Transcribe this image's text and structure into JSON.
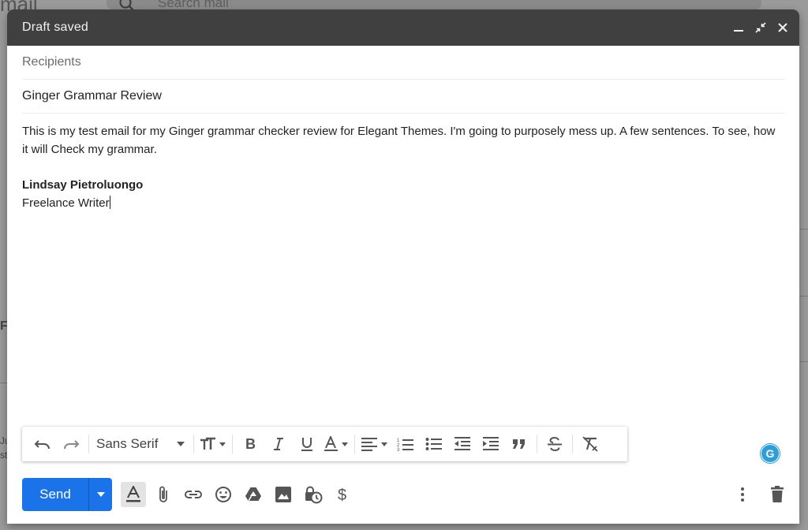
{
  "background": {
    "logo_fragment": "mail",
    "search_placeholder": "Search mail",
    "side_fragment": "Fo",
    "side_fragment_2": "Ju\nst"
  },
  "compose": {
    "title": "Draft saved",
    "recipients_placeholder": "Recipients",
    "subject": "Ginger Grammar Review",
    "body_line": "This is my test email for my Ginger grammar checker review for Elegant Themes. I'm going to purposely mess up. A few sentences. To see, how it will Check my grammar.",
    "signature_name": "Lindsay Pietroluongo",
    "signature_title": "Freelance Writer"
  },
  "toolbar": {
    "font_family": "Sans Serif"
  },
  "bottom": {
    "send_label": "Send"
  },
  "extension": {
    "grammarly_letter": "G"
  },
  "colors": {
    "titlebar": "#404040",
    "send": "#1a73e8",
    "grammarly": "#2d9ed9"
  }
}
